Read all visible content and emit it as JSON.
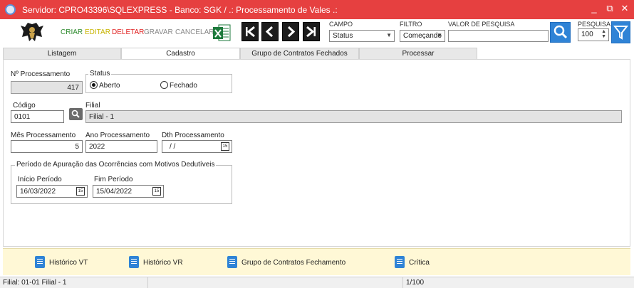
{
  "window": {
    "title": "Servidor: CPRO43396\\SQLEXPRESS - Banco: SGK / .: Processamento de Vales .:",
    "minimize_label": "_",
    "restore_label": "⧉",
    "close_label": "✕"
  },
  "toolbar": {
    "criar": "CRIAR",
    "editar": "EDITAR",
    "deletar": "DELETAR",
    "gravar": "GRAVAR",
    "cancelar": "CANCELAR",
    "colors": {
      "criar": "#2e8b2e",
      "editar": "#c8b400",
      "deletar": "#e02020",
      "disabled": "#888888"
    }
  },
  "search": {
    "campo_label": "CAMPO",
    "campo_value": "Status",
    "filtro_label": "FILTRO",
    "filtro_value": "Começando",
    "valor_label": "VALOR DE PESQUISA",
    "valor_value": "",
    "pesquisa_label": "PESQUISA",
    "pesquisa_value": "100"
  },
  "tabs": [
    "Listagem",
    "Cadastro",
    "Grupo de Contratos Fechados",
    "Processar"
  ],
  "form": {
    "nprocessamento_label": "Nº Processamento",
    "nprocessamento_value": "417",
    "status_label": "Status",
    "status_aberto": "Aberto",
    "status_fechado": "Fechado",
    "codigo_label": "Código",
    "codigo_value": "0101",
    "filial_label": "Filial",
    "filial_value": "Filial - 1",
    "mes_label": "Mês Processamento",
    "mes_value": "5",
    "ano_label": "Ano Processamento",
    "ano_value": "2022",
    "dth_label": "Dth Processamento",
    "dth_value": "/ /",
    "periodo_title": "Período de Apuração das Ocorrências com Motivos Dedutíveis",
    "inicio_label": "Início Período",
    "inicio_value": "16/03/2022",
    "fim_label": "Fim Período",
    "fim_value": "15/04/2022"
  },
  "bottom_actions": [
    "Histórico VT",
    "Histórico VR",
    "Grupo de Contratos Fechamento",
    "Crítica"
  ],
  "status": {
    "filial": "Filial: 01-01 Filial - 1",
    "records": "1/100"
  }
}
